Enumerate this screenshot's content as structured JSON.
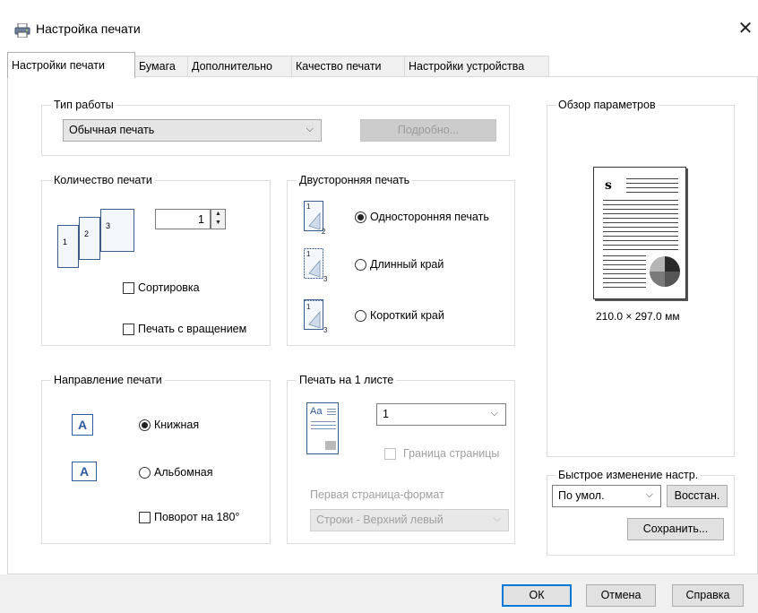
{
  "window": {
    "title": "Настройка печати",
    "close": "✕"
  },
  "tabs": [
    {
      "label": "Настройки печати"
    },
    {
      "label": "Бумага"
    },
    {
      "label": "Дополнительно"
    },
    {
      "label": "Качество печати"
    },
    {
      "label": "Настройки устройства"
    }
  ],
  "job_type": {
    "label": "Тип работы",
    "value": "Обычная печать",
    "details_btn": "Подробно..."
  },
  "copies": {
    "label": "Количество печати",
    "value": "1",
    "collate": "Сортировка",
    "rotate": "Печать с вращением",
    "page_nums": [
      "1",
      "2",
      "3"
    ]
  },
  "duplex": {
    "label": "Двусторонняя печать",
    "options": [
      {
        "label": "Односторонняя печать",
        "checked": true
      },
      {
        "label": "Длинный край",
        "checked": false
      },
      {
        "label": "Короткий край",
        "checked": false
      }
    ]
  },
  "orientation": {
    "label": "Направление печати",
    "options": [
      {
        "label": "Книжная",
        "checked": true
      },
      {
        "label": "Альбомная",
        "checked": false
      }
    ],
    "rotate180": "Поворот на 180°",
    "icon_letter": "A"
  },
  "nup": {
    "label": "Печать на 1 листе",
    "value": "1",
    "border": "Граница страницы",
    "order_label": "Первая страница-формат",
    "order_value": "Строки - Верхний левый",
    "icon_text": "Aa"
  },
  "overview": {
    "label": "Обзор параметров",
    "size": "210.0 × 297.0 мм",
    "sheet_letter": "s"
  },
  "quick": {
    "label": "Быстрое изменение настр.",
    "value": "По умол.",
    "restore": "Восстан.",
    "save": "Сохранить..."
  },
  "footer": {
    "ok": "ОК",
    "cancel": "Отмена",
    "help": "Справка"
  }
}
